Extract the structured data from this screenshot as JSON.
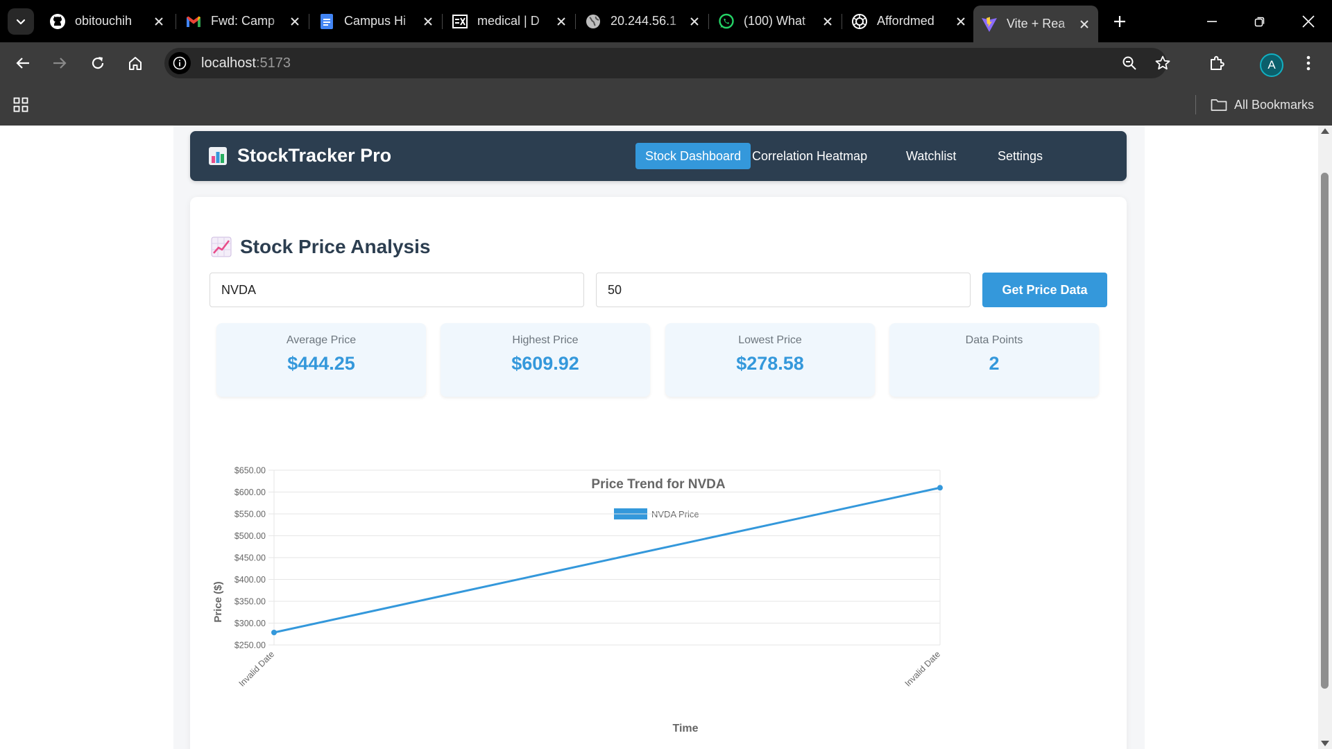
{
  "browser": {
    "tabs": [
      {
        "title": "obitouchih",
        "icon": "github-icon"
      },
      {
        "title": "Fwd: Camp",
        "icon": "gmail-icon"
      },
      {
        "title": "Campus Hi",
        "icon": "docs-icon"
      },
      {
        "title": "medical | D",
        "icon": "form-icon"
      },
      {
        "title": "20.244.56.1",
        "icon": "globe-icon"
      },
      {
        "title": "(100) What",
        "icon": "whatsapp-icon"
      },
      {
        "title": "Affordmed",
        "icon": "openai-icon"
      },
      {
        "title": "Vite + Rea",
        "icon": "vite-icon",
        "active": true
      }
    ],
    "url_host": "localhost",
    "url_port": ":5173",
    "profile_initial": "A",
    "bookmarks_label": "All Bookmarks"
  },
  "navbar": {
    "brand": "StockTracker Pro",
    "items": [
      "Stock Dashboard",
      "Correlation Heatmap",
      "Watchlist",
      "Settings"
    ],
    "active_index": 0
  },
  "analysis": {
    "title": "Stock Price Analysis",
    "ticker_value": "NVDA",
    "minutes_value": "50",
    "button_label": "Get Price Data"
  },
  "stats": [
    {
      "label": "Average Price",
      "value": "$444.25"
    },
    {
      "label": "Highest Price",
      "value": "$609.92"
    },
    {
      "label": "Lowest Price",
      "value": "$278.58"
    },
    {
      "label": "Data Points",
      "value": "2"
    }
  ],
  "chart_data": {
    "type": "line",
    "title": "Price Trend for NVDA",
    "xlabel": "Time",
    "ylabel": "Price ($)",
    "categories": [
      "Invalid Date",
      "Invalid Date"
    ],
    "series": [
      {
        "name": "NVDA Price",
        "values": [
          278.58,
          609.92
        ],
        "color": "#3498db"
      }
    ],
    "ylim": [
      250,
      650
    ],
    "yticks": [
      "$650.00",
      "$600.00",
      "$550.00",
      "$500.00",
      "$450.00",
      "$400.00",
      "$350.00",
      "$300.00",
      "$250.00"
    ],
    "grid": true,
    "legend_position": "top-center"
  },
  "colors": {
    "accent": "#3498db",
    "navbar": "#2c3e50"
  }
}
